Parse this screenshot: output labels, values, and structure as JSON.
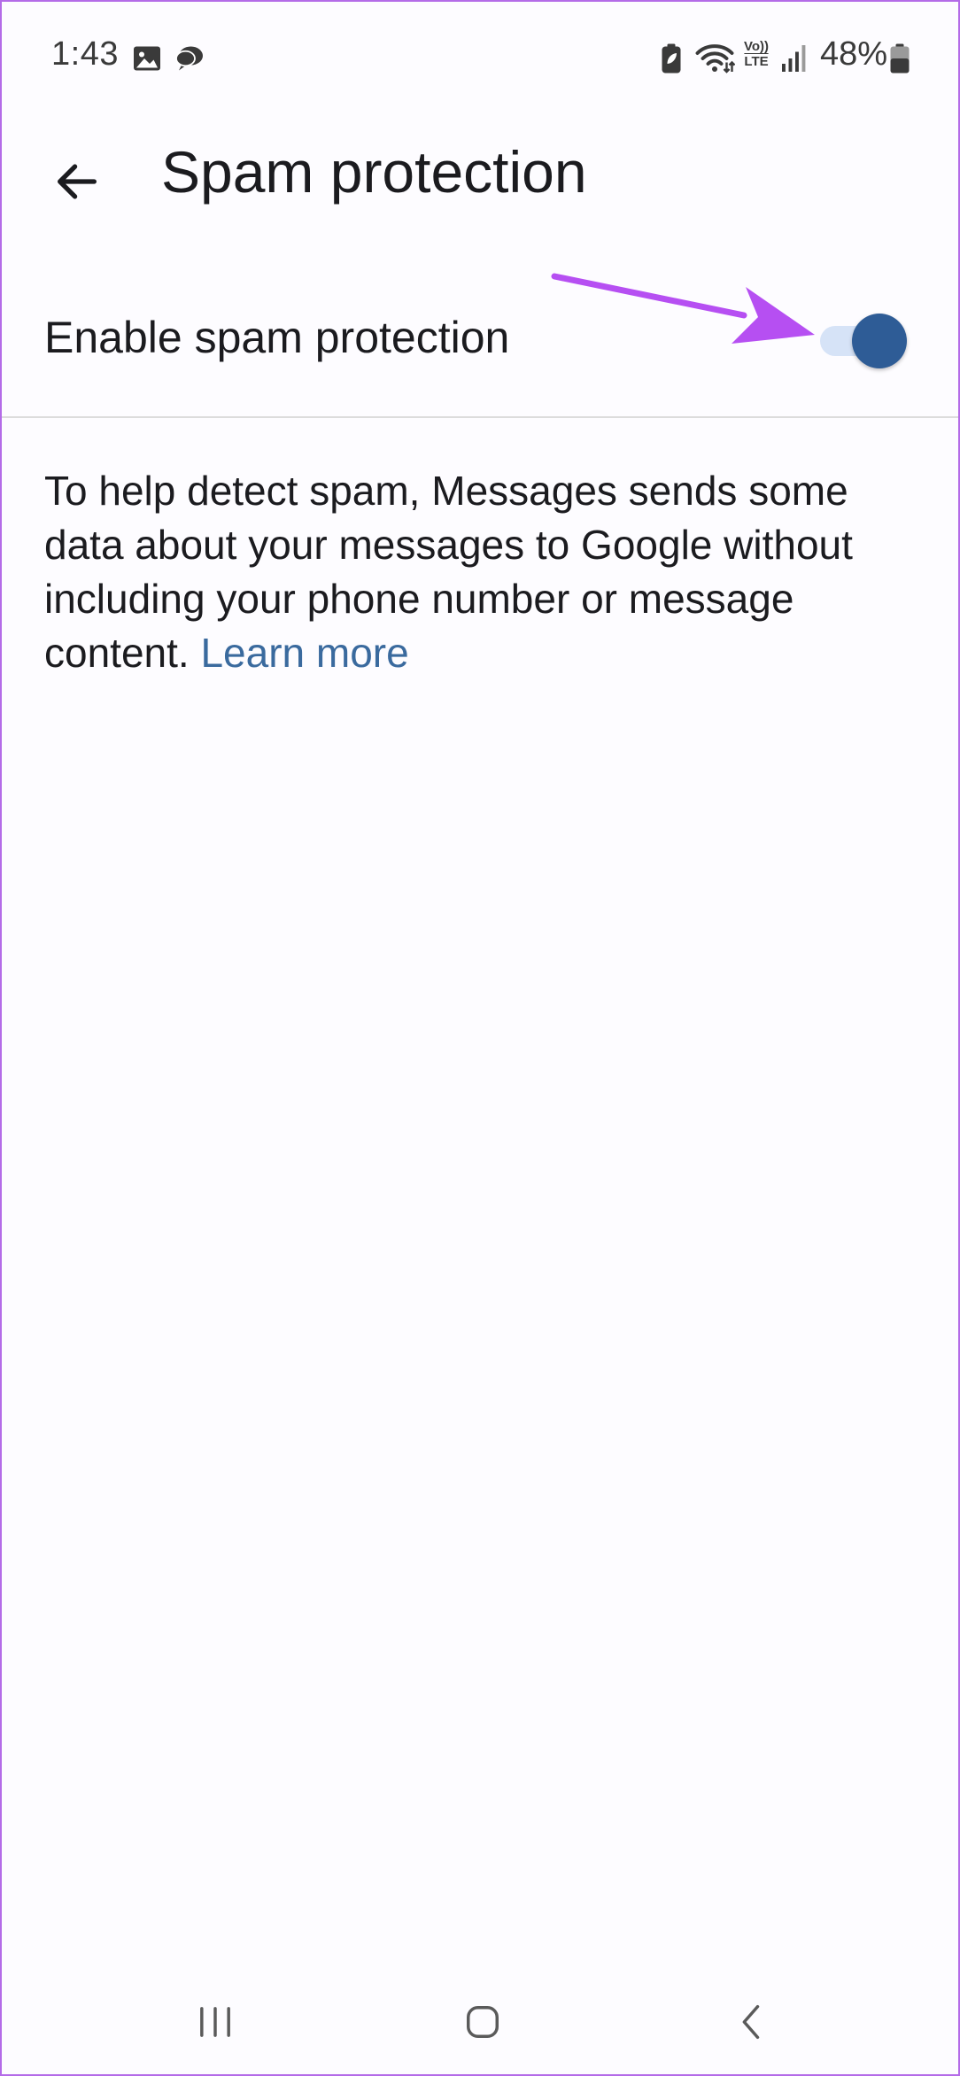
{
  "status_bar": {
    "time": "1:43",
    "battery_text": "48%",
    "left_icons": [
      "image-icon",
      "chat-bubble-icon"
    ],
    "right_icons": [
      "battery-saver-icon",
      "wifi-icon",
      "volte-icon",
      "signal-icon",
      "battery-icon"
    ],
    "volte_top": "Vo))",
    "volte_bottom": "LTE"
  },
  "app_bar": {
    "title": "Spam protection",
    "back_icon": "arrow-left-icon"
  },
  "settings": {
    "enable_label": "Enable spam protection",
    "enabled": true,
    "description": "To help detect spam, Messages sends some data about your messages to Google without including your phone number or message content.",
    "learn_more": "Learn more"
  },
  "annotation": {
    "arrow_color": "#b64ff2"
  },
  "colors": {
    "background": "#fdfcff",
    "switch_track": "#d6e3f7",
    "switch_thumb": "#2e5c96",
    "link": "#3a6a9e",
    "frame_border": "#b46be8"
  },
  "nav_bar": {
    "icons": [
      "recent-apps-icon",
      "home-icon",
      "back-icon"
    ]
  }
}
